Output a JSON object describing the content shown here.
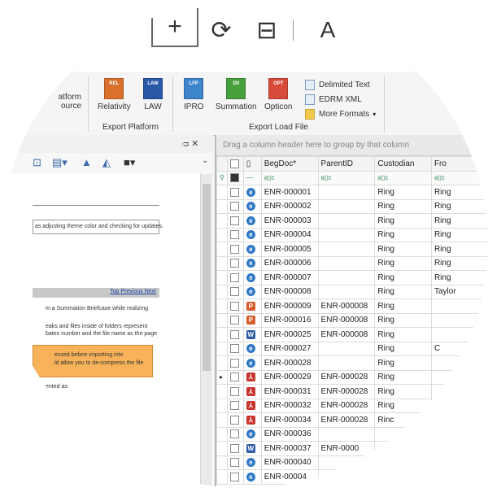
{
  "toolbar": {
    "plus_icon": "+",
    "rotate_icon": "⟳",
    "fit_icon": "⊟",
    "text_icon": "A"
  },
  "ribbon": {
    "partial_left_line1": "atform",
    "partial_left_line2": "ource",
    "platform_buttons": [
      {
        "label": "Relativity",
        "badge": "REL",
        "color": "#d9702b"
      },
      {
        "label": "LAW",
        "badge": "LAW",
        "color": "#2a58a8"
      }
    ],
    "load_buttons": [
      {
        "label": "IPRO",
        "badge": "LFP",
        "color": "#3c84cc"
      },
      {
        "label": "Summation",
        "badge": "DII",
        "color": "#48a03d"
      },
      {
        "label": "Opticon",
        "badge": "OPT",
        "color": "#d84a3a"
      }
    ],
    "small_buttons": [
      {
        "label": "Delimited Text"
      },
      {
        "label": "EDRM XML"
      },
      {
        "label": "More Formats"
      }
    ],
    "group_platform": "Export Platform",
    "group_load": "Export Load File"
  },
  "left_pane": {
    "pin_close": "ᴞ ✕",
    "doc_lines": [
      "as adjusting theme color and checking for updates.",
      "m a Summation Briefcase while realizing",
      "eaks and files inside of folders represent",
      "bates number and the file name as the page",
      "essed before importing into",
      "ld allow you to de-compress the file",
      "ented as:"
    ],
    "nav_links": [
      "Top",
      "Previous",
      "Next"
    ]
  },
  "grid": {
    "group_hint": "Drag a column header here to group by that column",
    "columns": [
      "BegDoc*",
      "ParentID",
      "Custodian",
      "Fro"
    ],
    "rows": [
      {
        "icon": "ie",
        "begdoc": "ENR-000001",
        "parent": "",
        "custodian": "Ring",
        "from": "Ring"
      },
      {
        "icon": "ie",
        "begdoc": "ENR-000002",
        "parent": "",
        "custodian": "Ring",
        "from": "Ring"
      },
      {
        "icon": "ie",
        "begdoc": "ENR-000003",
        "parent": "",
        "custodian": "Ring",
        "from": "Ring"
      },
      {
        "icon": "ie",
        "begdoc": "ENR-000004",
        "parent": "",
        "custodian": "Ring",
        "from": "Ring"
      },
      {
        "icon": "ie",
        "begdoc": "ENR-000005",
        "parent": "",
        "custodian": "Ring",
        "from": "Ring"
      },
      {
        "icon": "ie",
        "begdoc": "ENR-000006",
        "parent": "",
        "custodian": "Ring",
        "from": "Ring"
      },
      {
        "icon": "ie",
        "begdoc": "ENR-000007",
        "parent": "",
        "custodian": "Ring",
        "from": "Ring"
      },
      {
        "icon": "ie",
        "begdoc": "ENR-000008",
        "parent": "",
        "custodian": "Ring",
        "from": "Taylor"
      },
      {
        "icon": "ppt",
        "begdoc": "ENR-000009",
        "parent": "ENR-000008",
        "custodian": "Ring",
        "from": ""
      },
      {
        "icon": "ppt",
        "begdoc": "ENR-000016",
        "parent": "ENR-000008",
        "custodian": "Ring",
        "from": ""
      },
      {
        "icon": "doc",
        "begdoc": "ENR-000025",
        "parent": "ENR-000008",
        "custodian": "Ring",
        "from": ""
      },
      {
        "icon": "ie",
        "begdoc": "ENR-000027",
        "parent": "",
        "custodian": "Ring",
        "from": "C"
      },
      {
        "icon": "ie",
        "begdoc": "ENR-000028",
        "parent": "",
        "custodian": "Ring",
        "from": ""
      },
      {
        "icon": "pdf",
        "begdoc": "ENR-000029",
        "parent": "ENR-000028",
        "custodian": "Ring",
        "from": ""
      },
      {
        "icon": "pdf",
        "begdoc": "ENR-000031",
        "parent": "ENR-000028",
        "custodian": "Ring",
        "from": ""
      },
      {
        "icon": "pdf",
        "begdoc": "ENR-000032",
        "parent": "ENR-000028",
        "custodian": "Ring",
        "from": ""
      },
      {
        "icon": "pdf",
        "begdoc": "ENR-000034",
        "parent": "ENR-000028",
        "custodian": "Rinc",
        "from": ""
      },
      {
        "icon": "ie",
        "begdoc": "ENR-000036",
        "parent": "",
        "custodian": "",
        "from": ""
      },
      {
        "icon": "doc",
        "begdoc": "ENR-000037",
        "parent": "ENR-0000",
        "custodian": "",
        "from": ""
      },
      {
        "icon": "ie",
        "begdoc": "ENR-000040",
        "parent": "",
        "custodian": "",
        "from": ""
      },
      {
        "icon": "ie",
        "begdoc": "ENR-00004",
        "parent": "",
        "custodian": "",
        "from": ""
      }
    ]
  }
}
